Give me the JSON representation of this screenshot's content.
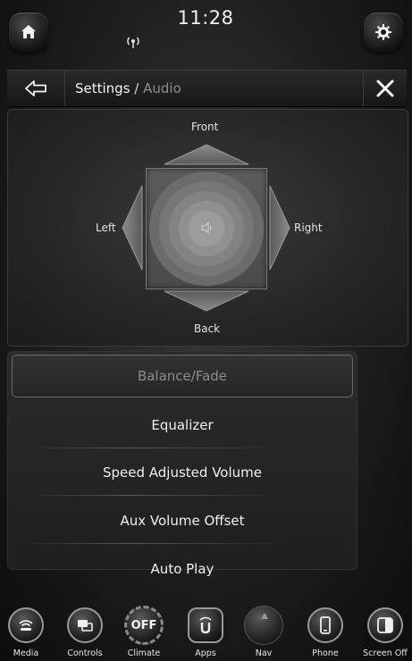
{
  "status": {
    "time": "11:28",
    "signal_icon": "wireless-signal-icon"
  },
  "header": {
    "back_icon": "back-arrow-icon",
    "breadcrumb_root": "Settings",
    "breadcrumb_sep": " / ",
    "breadcrumb_current": "Audio",
    "close_icon": "close-icon"
  },
  "balance": {
    "front_label": "Front",
    "back_label": "Back",
    "left_label": "Left",
    "right_label": "Right",
    "center_icon": "speaker-icon"
  },
  "menu": {
    "items": [
      {
        "label": "Balance/Fade",
        "selected": true
      },
      {
        "label": "Equalizer"
      },
      {
        "label": "Speed Adjusted Volume"
      },
      {
        "label": "Aux Volume Offset"
      },
      {
        "label": "Auto Play"
      }
    ]
  },
  "dock": {
    "items": [
      {
        "label": "Media",
        "icon": "media-icon"
      },
      {
        "label": "Controls",
        "icon": "controls-icon"
      },
      {
        "label": "Climate",
        "icon": "climate-off-icon",
        "text": "OFF"
      },
      {
        "label": "Apps",
        "icon": "apps-icon",
        "text": "Apps"
      },
      {
        "label": "Nav",
        "icon": "nav-icon"
      },
      {
        "label": "Phone",
        "icon": "phone-icon"
      },
      {
        "label": "Screen Off",
        "icon": "screen-off-icon"
      }
    ]
  },
  "colors": {
    "background": "#1d1d1d",
    "accent_border": "#6a6a6a",
    "muted_text": "#8e8e8e"
  }
}
